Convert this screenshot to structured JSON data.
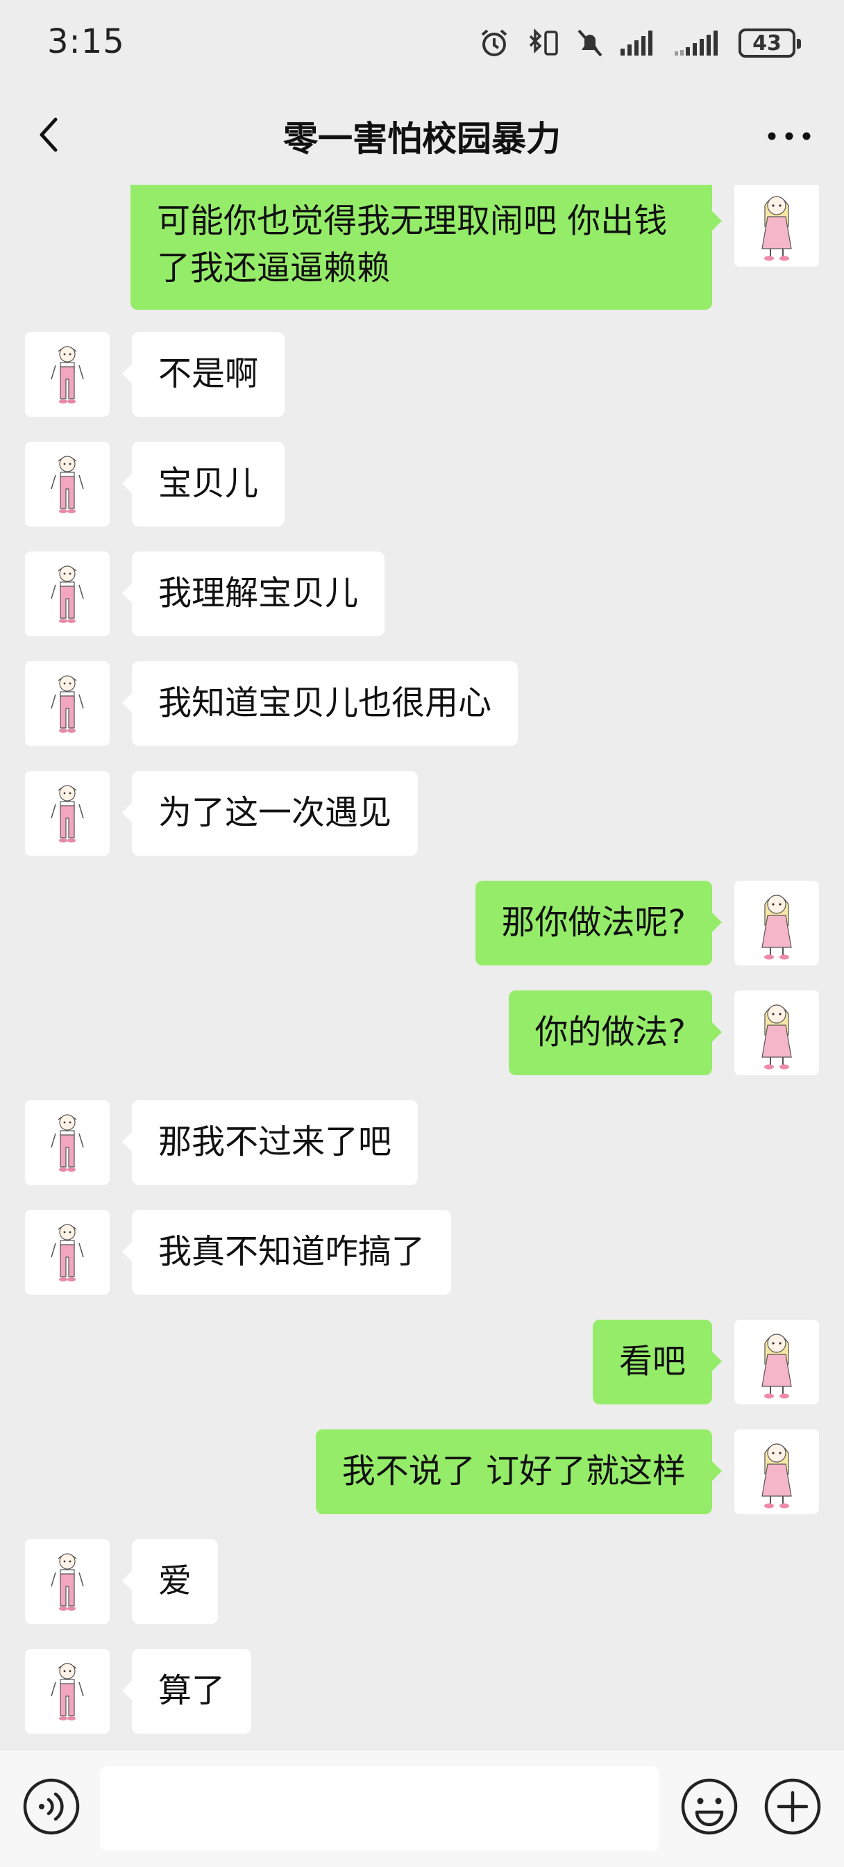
{
  "status_bar": {
    "time": "3:15",
    "battery": "43"
  },
  "header": {
    "title": "零一害怕校园暴力"
  },
  "messages": [
    {
      "side": "right",
      "text": "可能你也觉得我无理取闹吧 你出钱了我还逼逼赖赖"
    },
    {
      "side": "left",
      "text": "不是啊"
    },
    {
      "side": "left",
      "text": "宝贝儿"
    },
    {
      "side": "left",
      "text": "我理解宝贝儿"
    },
    {
      "side": "left",
      "text": "我知道宝贝儿也很用心"
    },
    {
      "side": "left",
      "text": "为了这一次遇见"
    },
    {
      "side": "right",
      "text": "那你做法呢?"
    },
    {
      "side": "right",
      "text": "你的做法?"
    },
    {
      "side": "left",
      "text": "那我不过来了吧"
    },
    {
      "side": "left",
      "text": "我真不知道咋搞了"
    },
    {
      "side": "right",
      "text": "看吧"
    },
    {
      "side": "right",
      "text": "我不说了 订好了就这样"
    },
    {
      "side": "left",
      "text": "爱"
    },
    {
      "side": "left",
      "text": "算了"
    }
  ],
  "input": {
    "value": ""
  },
  "icons": {
    "back": "back-arrow-icon",
    "more": "more-dots-icon",
    "voice": "voice-icon",
    "emoji": "emoji-icon",
    "plus": "plus-icon"
  },
  "colors": {
    "sent_bubble": "#95ec69",
    "received_bubble": "#ffffff",
    "background": "#ededed"
  }
}
